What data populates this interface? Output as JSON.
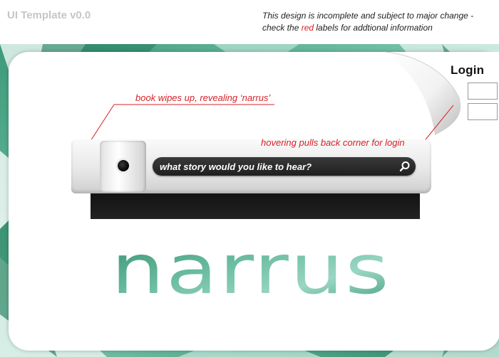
{
  "header": {
    "template_title": "UI Template v0.0",
    "disclaimer_line1": "This design is incomplete and subject to major change -",
    "disclaimer_line2_pre": "check the ",
    "disclaimer_line2_red": "red",
    "disclaimer_line2_post": " labels for addtional information"
  },
  "login": {
    "label": "Login"
  },
  "annotations": {
    "book": "book wipes up, revealing ‘narrus’",
    "hover": "hovering pulls back corner for login"
  },
  "search": {
    "placeholder": "what story would you like to hear?"
  },
  "logo": {
    "text": "narrus"
  },
  "colors": {
    "annotation_red": "#d72027",
    "teal_dark": "#2e8a6a",
    "teal_light": "#8fd0bf",
    "search_bar": "#2a2a2a"
  },
  "icons": {
    "search": "magnifier-icon",
    "hinge": "book-hinge-icon"
  }
}
